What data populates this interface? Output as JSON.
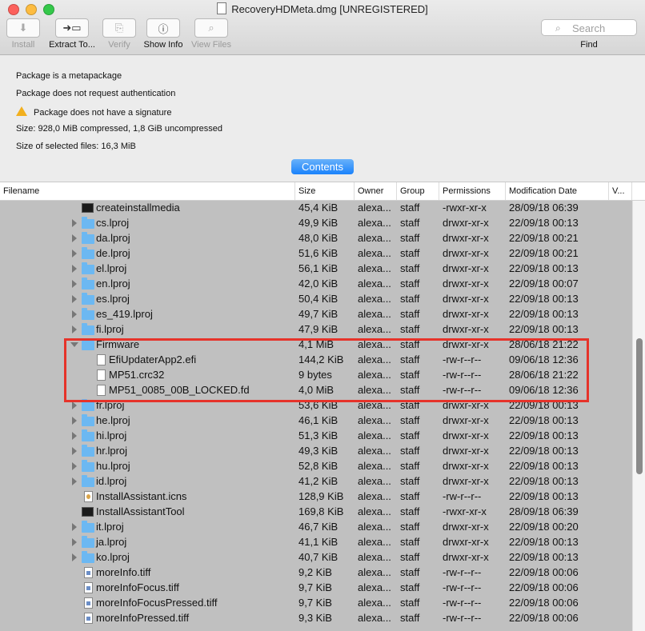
{
  "window": {
    "title": "RecoveryHDMeta.dmg [UNREGISTERED]"
  },
  "toolbar": {
    "buttons": [
      {
        "label": "Install",
        "icon": "download-arrow-icon",
        "glyph": "⬇",
        "enabled": false
      },
      {
        "label": "Extract To...",
        "icon": "extract-folder-icon",
        "glyph": "➜▭",
        "enabled": true
      },
      {
        "label": "Verify",
        "icon": "verify-icon",
        "glyph": "⎘",
        "enabled": false
      },
      {
        "label": "Show Info",
        "icon": "info-icon",
        "glyph": "ⓘ",
        "enabled": true
      },
      {
        "label": "View Files",
        "icon": "magnifier-icon",
        "glyph": "⌕",
        "enabled": false
      }
    ],
    "search_placeholder": "Search",
    "find_label": "Find"
  },
  "info": {
    "lines": [
      "Package is a metapackage",
      "Package does not request authentication",
      "Package does not have a signature",
      "Size: 928,0 MiB compressed, 1,8 GiB uncompressed",
      "Size of selected files: 16,3 MiB"
    ],
    "warning_color": "#f2b01e"
  },
  "contents_button": "Contents",
  "accent_color": "#1a82fb",
  "highlight_color": "#e6332a",
  "table": {
    "columns": [
      "Filename",
      "Size",
      "Owner",
      "Group",
      "Permissions",
      "Modification Date",
      "V..."
    ],
    "rows": [
      {
        "name": "createinstallmedia",
        "icon": "exec",
        "disclosure": "none",
        "level": 0,
        "size": "45,4 KiB",
        "owner": "alexa...",
        "group": "staff",
        "perm": "-rwxr-xr-x",
        "date": "28/09/18 06:39"
      },
      {
        "name": "cs.lproj",
        "icon": "folder",
        "disclosure": "closed",
        "level": 0,
        "size": "49,9 KiB",
        "owner": "alexa...",
        "group": "staff",
        "perm": "drwxr-xr-x",
        "date": "22/09/18 00:13"
      },
      {
        "name": "da.lproj",
        "icon": "folder",
        "disclosure": "closed",
        "level": 0,
        "size": "48,0 KiB",
        "owner": "alexa...",
        "group": "staff",
        "perm": "drwxr-xr-x",
        "date": "22/09/18 00:21"
      },
      {
        "name": "de.lproj",
        "icon": "folder",
        "disclosure": "closed",
        "level": 0,
        "size": "51,6 KiB",
        "owner": "alexa...",
        "group": "staff",
        "perm": "drwxr-xr-x",
        "date": "22/09/18 00:21"
      },
      {
        "name": "el.lproj",
        "icon": "folder",
        "disclosure": "closed",
        "level": 0,
        "size": "56,1 KiB",
        "owner": "alexa...",
        "group": "staff",
        "perm": "drwxr-xr-x",
        "date": "22/09/18 00:13"
      },
      {
        "name": "en.lproj",
        "icon": "folder",
        "disclosure": "closed",
        "level": 0,
        "size": "42,0 KiB",
        "owner": "alexa...",
        "group": "staff",
        "perm": "drwxr-xr-x",
        "date": "22/09/18 00:07"
      },
      {
        "name": "es.lproj",
        "icon": "folder",
        "disclosure": "closed",
        "level": 0,
        "size": "50,4 KiB",
        "owner": "alexa...",
        "group": "staff",
        "perm": "drwxr-xr-x",
        "date": "22/09/18 00:13"
      },
      {
        "name": "es_419.lproj",
        "icon": "folder",
        "disclosure": "closed",
        "level": 0,
        "size": "49,7 KiB",
        "owner": "alexa...",
        "group": "staff",
        "perm": "drwxr-xr-x",
        "date": "22/09/18 00:13"
      },
      {
        "name": "fi.lproj",
        "icon": "folder",
        "disclosure": "closed",
        "level": 0,
        "size": "47,9 KiB",
        "owner": "alexa...",
        "group": "staff",
        "perm": "drwxr-xr-x",
        "date": "22/09/18 00:13"
      },
      {
        "name": "Firmware",
        "icon": "folder",
        "disclosure": "open",
        "level": 0,
        "size": "4,1 MiB",
        "owner": "alexa...",
        "group": "staff",
        "perm": "drwxr-xr-x",
        "date": "28/06/18 21:22"
      },
      {
        "name": "EfiUpdaterApp2.efi",
        "icon": "file",
        "disclosure": "none",
        "level": 1,
        "size": "144,2 KiB",
        "owner": "alexa...",
        "group": "staff",
        "perm": "-rw-r--r--",
        "date": "09/06/18 12:36"
      },
      {
        "name": "MP51.crc32",
        "icon": "file",
        "disclosure": "none",
        "level": 1,
        "size": "9 bytes",
        "owner": "alexa...",
        "group": "staff",
        "perm": "-rw-r--r--",
        "date": "28/06/18 21:22"
      },
      {
        "name": "MP51_0085_00B_LOCKED.fd",
        "icon": "file",
        "disclosure": "none",
        "level": 1,
        "size": "4,0 MiB",
        "owner": "alexa...",
        "group": "staff",
        "perm": "-rw-r--r--",
        "date": "09/06/18 12:36"
      },
      {
        "name": "fr.lproj",
        "icon": "folder",
        "disclosure": "closed",
        "level": 0,
        "size": "53,6 KiB",
        "owner": "alexa...",
        "group": "staff",
        "perm": "drwxr-xr-x",
        "date": "22/09/18 00:13"
      },
      {
        "name": "he.lproj",
        "icon": "folder",
        "disclosure": "closed",
        "level": 0,
        "size": "46,1 KiB",
        "owner": "alexa...",
        "group": "staff",
        "perm": "drwxr-xr-x",
        "date": "22/09/18 00:13"
      },
      {
        "name": "hi.lproj",
        "icon": "folder",
        "disclosure": "closed",
        "level": 0,
        "size": "51,3 KiB",
        "owner": "alexa...",
        "group": "staff",
        "perm": "drwxr-xr-x",
        "date": "22/09/18 00:13"
      },
      {
        "name": "hr.lproj",
        "icon": "folder",
        "disclosure": "closed",
        "level": 0,
        "size": "49,3 KiB",
        "owner": "alexa...",
        "group": "staff",
        "perm": "drwxr-xr-x",
        "date": "22/09/18 00:13"
      },
      {
        "name": "hu.lproj",
        "icon": "folder",
        "disclosure": "closed",
        "level": 0,
        "size": "52,8 KiB",
        "owner": "alexa...",
        "group": "staff",
        "perm": "drwxr-xr-x",
        "date": "22/09/18 00:13"
      },
      {
        "name": "id.lproj",
        "icon": "folder",
        "disclosure": "closed",
        "level": 0,
        "size": "41,2 KiB",
        "owner": "alexa...",
        "group": "staff",
        "perm": "drwxr-xr-x",
        "date": "22/09/18 00:13"
      },
      {
        "name": "InstallAssistant.icns",
        "icon": "icns",
        "disclosure": "none",
        "level": 0,
        "size": "128,9 KiB",
        "owner": "alexa...",
        "group": "staff",
        "perm": "-rw-r--r--",
        "date": "22/09/18 00:13"
      },
      {
        "name": "InstallAssistantTool",
        "icon": "exec",
        "disclosure": "none",
        "level": 0,
        "size": "169,8 KiB",
        "owner": "alexa...",
        "group": "staff",
        "perm": "-rwxr-xr-x",
        "date": "28/09/18 06:39"
      },
      {
        "name": "it.lproj",
        "icon": "folder",
        "disclosure": "closed",
        "level": 0,
        "size": "46,7 KiB",
        "owner": "alexa...",
        "group": "staff",
        "perm": "drwxr-xr-x",
        "date": "22/09/18 00:20"
      },
      {
        "name": "ja.lproj",
        "icon": "folder",
        "disclosure": "closed",
        "level": 0,
        "size": "41,1 KiB",
        "owner": "alexa...",
        "group": "staff",
        "perm": "drwxr-xr-x",
        "date": "22/09/18 00:13"
      },
      {
        "name": "ko.lproj",
        "icon": "folder",
        "disclosure": "closed",
        "level": 0,
        "size": "40,7 KiB",
        "owner": "alexa...",
        "group": "staff",
        "perm": "drwxr-xr-x",
        "date": "22/09/18 00:13"
      },
      {
        "name": "moreInfo.tiff",
        "icon": "tiff",
        "disclosure": "none",
        "level": 0,
        "size": "9,2 KiB",
        "owner": "alexa...",
        "group": "staff",
        "perm": "-rw-r--r--",
        "date": "22/09/18 00:06"
      },
      {
        "name": "moreInfoFocus.tiff",
        "icon": "tiff",
        "disclosure": "none",
        "level": 0,
        "size": "9,7 KiB",
        "owner": "alexa...",
        "group": "staff",
        "perm": "-rw-r--r--",
        "date": "22/09/18 00:06"
      },
      {
        "name": "moreInfoFocusPressed.tiff",
        "icon": "tiff",
        "disclosure": "none",
        "level": 0,
        "size": "9,7 KiB",
        "owner": "alexa...",
        "group": "staff",
        "perm": "-rw-r--r--",
        "date": "22/09/18 00:06"
      },
      {
        "name": "moreInfoPressed.tiff",
        "icon": "tiff",
        "disclosure": "none",
        "level": 0,
        "size": "9,3 KiB",
        "owner": "alexa...",
        "group": "staff",
        "perm": "-rw-r--r--",
        "date": "22/09/18 00:06"
      }
    ]
  }
}
